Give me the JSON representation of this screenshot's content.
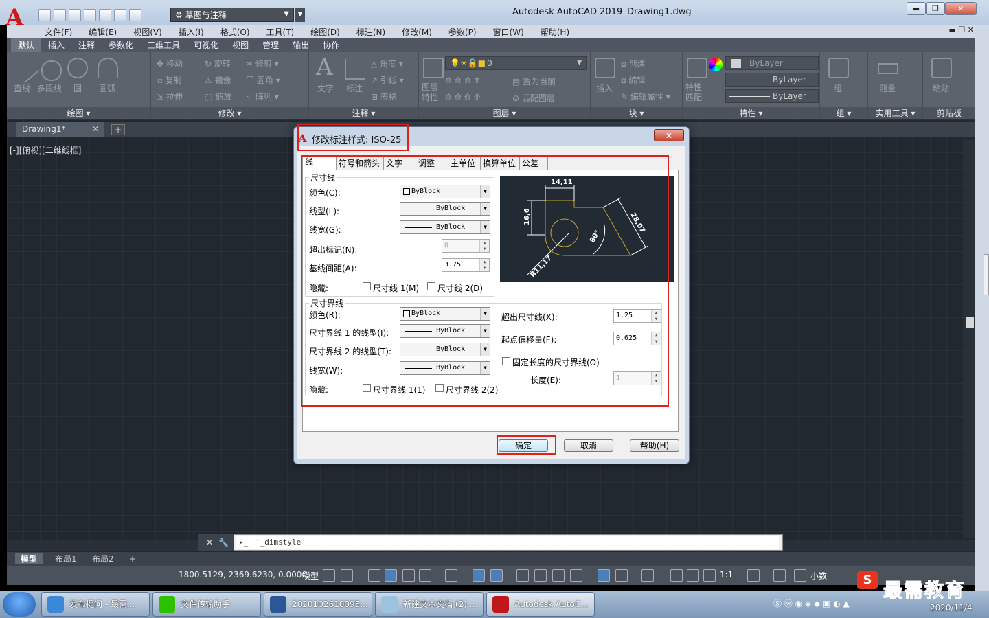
{
  "app": {
    "logo_letter": "A",
    "title": "Autodesk AutoCAD 2019",
    "document": "Drawing1.dwg",
    "workspace": "草图与注释",
    "accent": "#d01818"
  },
  "menu": [
    "文件(F)",
    "编辑(E)",
    "视图(V)",
    "插入(I)",
    "格式(O)",
    "工具(T)",
    "绘图(D)",
    "标注(N)",
    "修改(M)",
    "参数(P)",
    "窗口(W)",
    "帮助(H)"
  ],
  "ribbon_tabs": [
    "默认",
    "插入",
    "注释",
    "参数化",
    "三维工具",
    "可视化",
    "视图",
    "管理",
    "输出",
    "协作"
  ],
  "ribbon": {
    "draw": {
      "label": "绘图",
      "tools": [
        "直线",
        "多段线",
        "圆",
        "圆弧"
      ]
    },
    "modify": {
      "label": "修改",
      "tools": [
        "移动",
        "旋转",
        "修剪",
        "复制",
        "镜像",
        "圆角",
        "拉伸",
        "缩放",
        "阵列"
      ]
    },
    "annotation": {
      "label": "注释",
      "tools": [
        "文字",
        "标注",
        "角度",
        "引线",
        "表格"
      ]
    },
    "layers": {
      "label": "图层",
      "current_layer": "0",
      "tools": [
        "图层特性",
        "置为当前",
        "匹配图层"
      ]
    },
    "block": {
      "label": "块",
      "tools": [
        "插入",
        "创建",
        "编辑",
        "编辑属性"
      ]
    },
    "properties": {
      "label": "特性",
      "color": "ByLayer",
      "linetype": "ByLayer",
      "lineweight": "ByLayer",
      "tools": [
        "特性匹配"
      ]
    },
    "groups": {
      "label": "组",
      "tools": [
        "组"
      ]
    },
    "utilities": {
      "label": "实用工具",
      "tools": [
        "测量"
      ]
    },
    "clipboard": {
      "label": "剪贴板",
      "tools": [
        "粘贴"
      ]
    }
  },
  "file_tab": "Drawing1*",
  "viewport_label": "[-][俯视][二维线框]",
  "command_line": {
    "text": "'_dimstyle"
  },
  "layout_tabs": [
    "模型",
    "布局1",
    "布局2"
  ],
  "status": {
    "coords": "1800.5129, 2369.6230, 0.0000",
    "model": "模型",
    "scale": "1:1",
    "units": "小数"
  },
  "dialog": {
    "title": "修改标注样式: ISO-25",
    "close": "x",
    "tabs": [
      "线",
      "符号和箭头",
      "文字",
      "调整",
      "主单位",
      "换算单位",
      "公差"
    ],
    "dim_lines": {
      "group": "尺寸线",
      "color_label": "颜色(C):",
      "color_value": "ByBlock",
      "linetype_label": "线型(L):",
      "linetype_value": "ByBlock",
      "lineweight_label": "线宽(G):",
      "lineweight_value": "ByBlock",
      "extend_label": "超出标记(N):",
      "extend_value": "0",
      "baseline_label": "基线间距(A):",
      "baseline_value": "3.75",
      "suppress_label": "隐藏:",
      "suppress_1": "尺寸线 1(M)",
      "suppress_2": "尺寸线 2(D)"
    },
    "ext_lines": {
      "group": "尺寸界线",
      "color_label": "颜色(R):",
      "color_value": "ByBlock",
      "linetype1_label": "尺寸界线 1 的线型(I):",
      "linetype1_value": "ByBlock",
      "linetype2_label": "尺寸界线 2 的线型(T):",
      "linetype2_value": "ByBlock",
      "lineweight_label": "线宽(W):",
      "lineweight_value": "ByBlock",
      "suppress_label": "隐藏:",
      "suppress_1": "尺寸界线 1(1)",
      "suppress_2": "尺寸界线 2(2)",
      "beyond_label": "超出尺寸线(X):",
      "beyond_value": "1.25",
      "offset_label": "起点偏移量(F):",
      "offset_value": "0.625",
      "fixed_label": "固定长度的尺寸界线(O)",
      "length_label": "长度(E):",
      "length_value": "1"
    },
    "preview": {
      "d1": "14,11",
      "d2": "16,6",
      "d3": "28,07",
      "d4": "80°",
      "d5": "R11,17"
    },
    "buttons": {
      "ok": "确定",
      "cancel": "取消",
      "help": "帮助(H)"
    }
  },
  "taskbar": {
    "items": [
      "发布提问 - 最需...",
      "文件传输助手",
      "2020102610095...",
      "新建文本文档 (2) ...",
      "Autodesk AutoC..."
    ],
    "clock_date": "2020/11/4"
  },
  "watermark": {
    "text": "最需教育"
  }
}
